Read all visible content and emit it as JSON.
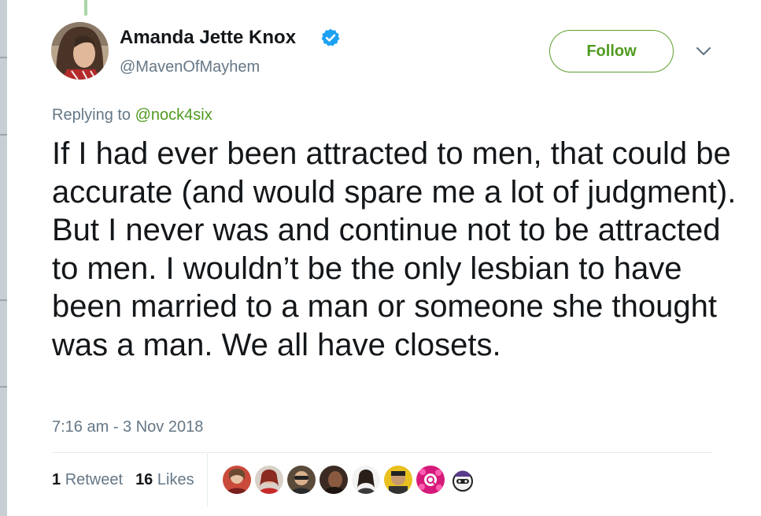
{
  "tweet": {
    "author": {
      "display_name": "Amanda Jette Knox",
      "handle": "@MavenOfMayhem",
      "verified": true,
      "avatar_icon": "user-avatar-photo"
    },
    "follow_button_label": "Follow",
    "menu_icon": "chevron-down-icon",
    "replying_prefix": "Replying to",
    "replying_to": "@nock4six",
    "text": "If I had ever been attracted to men, that could be accurate (and would spare me a lot of judgment). But I never was and continue not to be attracted to men. I wouldn’t be the only lesbian to have been married to a man or someone she thought was a man. We all have closets.",
    "timestamp": "7:16 am - 3 Nov 2018",
    "stats": {
      "retweets_count": "1",
      "retweets_label": "Retweet",
      "likes_count": "16",
      "likes_label": "Likes"
    },
    "likers_count": 8
  },
  "colors": {
    "accent_green": "#4f9a1f",
    "verified_blue": "#1da1f2",
    "text_primary": "#14171a",
    "text_secondary": "#657786"
  }
}
